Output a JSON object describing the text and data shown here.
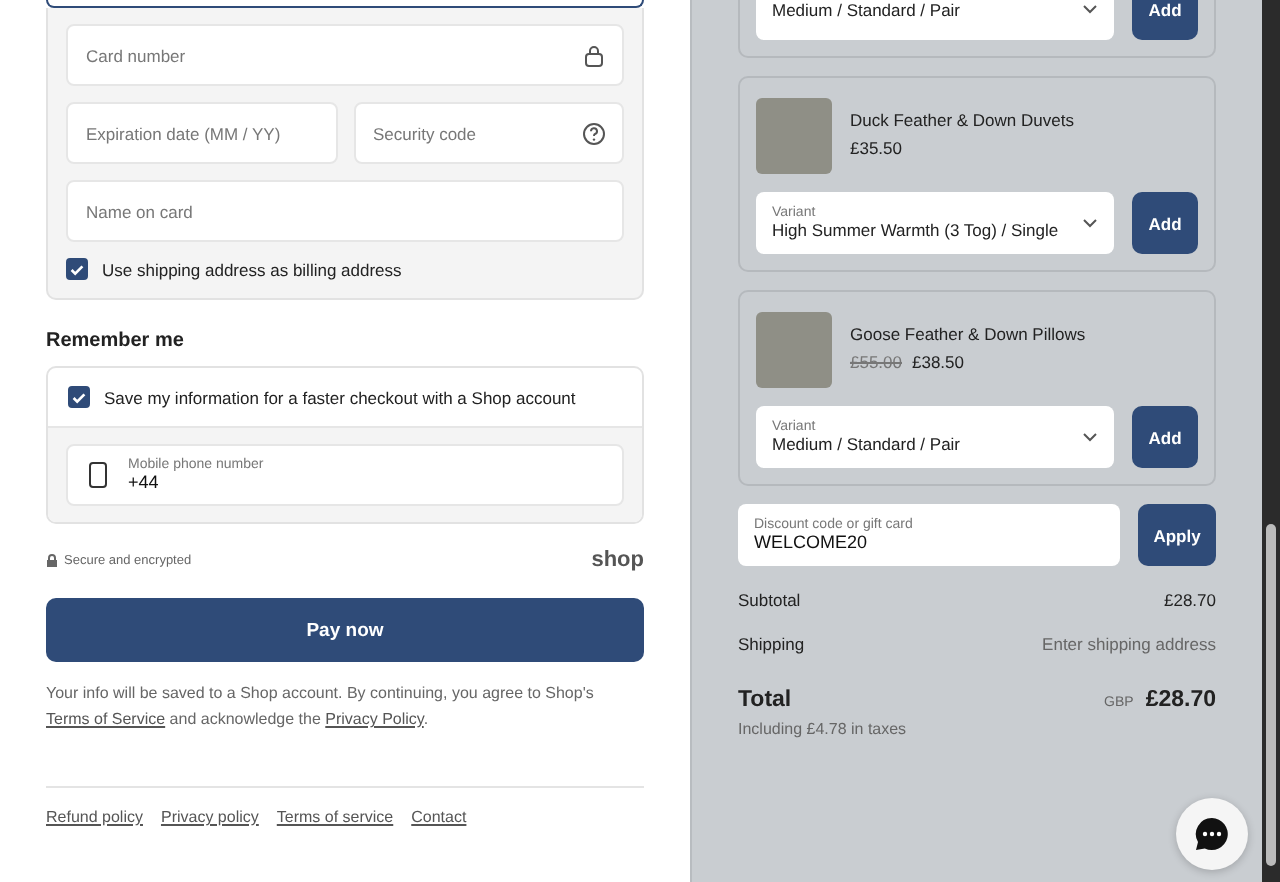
{
  "payment": {
    "fields": [
      {
        "kind": "card",
        "placeholder": "Card number"
      },
      {
        "kind": "expiry",
        "placeholder": "Expiration date (MM / YY)"
      },
      {
        "kind": "cvv",
        "placeholder": "Security code"
      },
      {
        "kind": "name",
        "placeholder": "Name on card"
      }
    ],
    "billing_checkbox": {
      "label": "Use shipping address as billing address",
      "checked": true
    }
  },
  "remember_me": {
    "heading": "Remember me",
    "checkbox": {
      "label": "Save my information for a faster checkout with a Shop account",
      "checked": true
    },
    "phone": {
      "label": "Mobile phone number",
      "value": "+44"
    }
  },
  "secure_note": "Secure and encrypted",
  "shop_logo": "shop",
  "pay_button": "Pay now",
  "consent": [
    {
      "kind": "text",
      "text": "Your info will be saved to a Shop account. By continuing, you agree to Shop's "
    },
    {
      "kind": "link",
      "text": "Terms of Service"
    },
    {
      "kind": "text",
      "text": " and acknowledge the "
    },
    {
      "kind": "link",
      "text": "Privacy Policy"
    },
    {
      "kind": "text",
      "text": "."
    }
  ],
  "footer_links": [
    "Refund policy",
    "Privacy policy",
    "Terms of service",
    "Contact"
  ],
  "products": [
    {
      "variant": "Medium / Standard / Pair",
      "button": "Add"
    },
    {
      "name": "Duck Feather & Down Duvets",
      "price": "£35.50",
      "variant_label": "Variant",
      "variant": "High Summer Warmth (3 Tog) / Single",
      "button": "Add"
    },
    {
      "name": "Goose Feather & Down Pillows",
      "original_price": "£55.00",
      "price": "£38.50",
      "variant_label": "Variant",
      "variant": "Medium / Standard / Pair",
      "button": "Add"
    }
  ],
  "discount": {
    "label": "Discount code or gift card",
    "value": "WELCOME20",
    "button": "Apply"
  },
  "summary": [
    {
      "label": "Subtotal",
      "value": "£28.70",
      "kind": "amount"
    },
    {
      "label": "Shipping",
      "value": "Enter shipping address",
      "kind": "note"
    }
  ],
  "total": {
    "label": "Total",
    "currency": "GBP",
    "value": "£28.70",
    "taxes": "Including £4.78 in taxes"
  }
}
